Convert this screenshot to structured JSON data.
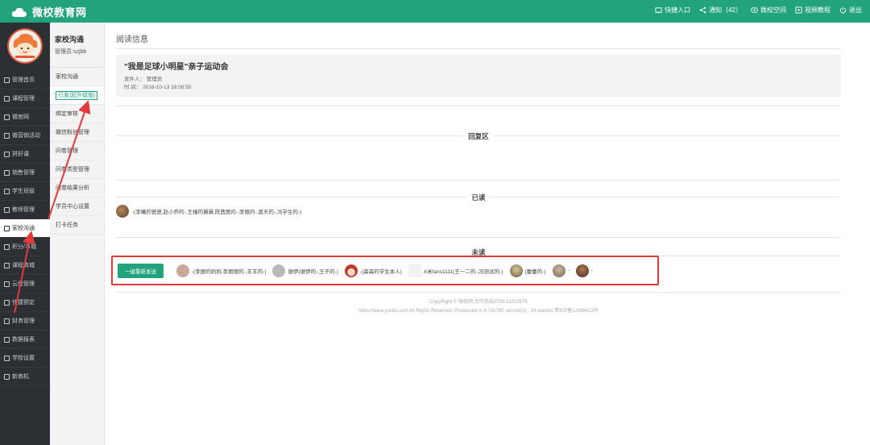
{
  "app": {
    "title": "微校教育网"
  },
  "top_actions": [
    {
      "label": "快捷入口",
      "icon": "quick-entry-icon"
    },
    {
      "label": "通知（42）",
      "icon": "share-icon"
    },
    {
      "label": "微校空间",
      "icon": "space-icon"
    },
    {
      "label": "视频教程",
      "icon": "video-icon"
    },
    {
      "label": "退出",
      "icon": "power-icon"
    }
  ],
  "sidebar": {
    "items": [
      {
        "label": "管理首页"
      },
      {
        "label": "课程管理"
      },
      {
        "label": "微官网"
      },
      {
        "label": "微营销活动"
      },
      {
        "label": "拼好课"
      },
      {
        "label": "销售管理"
      },
      {
        "label": "学生班级"
      },
      {
        "label": "教师管理"
      },
      {
        "label": "家校沟通"
      },
      {
        "label": "积分/币城"
      },
      {
        "label": "课程商城"
      },
      {
        "label": "云盘管理"
      },
      {
        "label": "快捷预定"
      },
      {
        "label": "财务管理"
      },
      {
        "label": "数据报表"
      },
      {
        "label": "学校设置"
      },
      {
        "label": "新商机"
      }
    ],
    "active_index": 8
  },
  "subside": {
    "title": "家校沟通",
    "user": "管理员:szjbb",
    "items": [
      {
        "label": "家校沟通"
      },
      {
        "label": "已发送[升级版]"
      },
      {
        "label": "绑定审核"
      },
      {
        "label": "微信粉丝管理"
      },
      {
        "label": "问卷管理"
      },
      {
        "label": "问卷类型管理"
      },
      {
        "label": "问卷结果分析"
      },
      {
        "label": "学员中心设置"
      },
      {
        "label": "打卡任务"
      }
    ],
    "active_index": 1
  },
  "main": {
    "page_title": "阅读信息",
    "notice": {
      "title": "\"我是足球小明星\"亲子运动会",
      "sender_label": "发件人：",
      "sender": "管理员",
      "time_label": "时 间：",
      "time": "2018-10-13 16:08:50"
    },
    "reply_section": "回复区",
    "read_section": "已读",
    "read_list": "-(李曦的爸爸,赵小乔的-,王橦的舅舅,陈茜茜的-,李丽的-,恩天的-,冯学生的-)",
    "unread_section": "未读",
    "resend_button": "一键重新发送",
    "unread_items": [
      {
        "text": "-(李丽的妈妈,李丽丽的-,羊羊的-)",
        "color": "#c9a99a"
      },
      {
        "text": "谢伊(谢伊的-,王子的-)",
        "color": "#b9b9b9"
      },
      {
        "text": "-(森森的学生本人)",
        "color": "#c0392b"
      },
      {
        "text": "A米fans1111(王一二的-,冯测试的-)",
        "color": "#e6e6e6"
      },
      {
        "text": "(蕾蕾的-)",
        "color": "#8c7a5a"
      },
      {
        "text": "-",
        "color": "#a08a70"
      },
      {
        "text": "-",
        "color": "#7a4a3a"
      }
    ],
    "footer_line1": "CopyRight © 微校网 合作热线0755-23213576",
    "footer_line2": "https://www.yun61.com All Rights Reserved. Processed in 4.742780 second(s) , 24 queries 粤ICP备12086413号"
  }
}
